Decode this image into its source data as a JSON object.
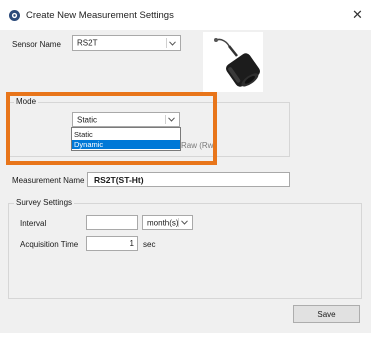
{
  "window": {
    "title": "Create New Measurement Settings",
    "close_glyph": "✕"
  },
  "sensor": {
    "label": "Sensor Name",
    "value": "RS2T"
  },
  "mode": {
    "group_label": "Mode",
    "selected": "Static",
    "options": [
      "Static",
      "Dynamic"
    ],
    "highlighted_option": "Dynamic",
    "partial_text": "Raw (Rw)",
    "highlight_color": "#e8751a"
  },
  "measurement": {
    "label": "Measurement Name",
    "value": "RS2T(ST-Ht)"
  },
  "survey": {
    "group_label": "Survey Settings",
    "interval_label": "Interval",
    "interval_value": "",
    "interval_unit": "month(s)",
    "acquisition_label": "Acquisition Time",
    "acquisition_value": "1",
    "acquisition_unit": "sec"
  },
  "save_label": "Save"
}
